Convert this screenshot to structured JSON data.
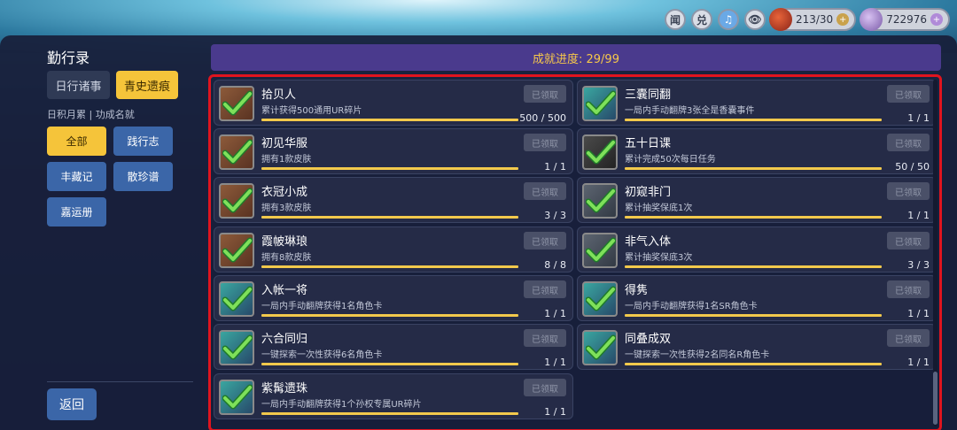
{
  "topbar": {
    "buttons": [
      {
        "label": "闻",
        "icon": "news-icon"
      },
      {
        "label": "兑",
        "icon": "exchange-icon"
      },
      {
        "label": "♫",
        "icon": "music-icon"
      },
      {
        "label": "👁",
        "icon": "eye-icon"
      }
    ],
    "stamina": {
      "value": "213/30",
      "icon": "pouch-icon"
    },
    "pearls": {
      "value": "722976",
      "icon": "pearl-icon"
    }
  },
  "sidebar": {
    "title": "勤行录",
    "tabs": [
      "日行诸事",
      "青史遗痕"
    ],
    "subtitle": "日积月累 | 功成名就",
    "categories": [
      "全部",
      "践行志",
      "丰藏记",
      "散珍谱",
      "嘉运册"
    ],
    "back_label": "返回"
  },
  "header": {
    "progress": "成就进度: 29/99"
  },
  "claim_label": "已领取",
  "achievements": [
    {
      "name": "拾贝人",
      "desc": "累计获得500通用UR碎片",
      "count": "500 / 500",
      "progress": 1.0,
      "thumb": "brown"
    },
    {
      "name": "三囊同翻",
      "desc": "一局内手动翻牌3张全是香囊事件",
      "count": "1 / 1",
      "progress": 1.0,
      "thumb": "teal"
    },
    {
      "name": "初见华服",
      "desc": "拥有1款皮肤",
      "count": "1 / 1",
      "progress": 1.0,
      "thumb": "brown"
    },
    {
      "name": "五十日课",
      "desc": "累计完成50次每日任务",
      "count": "50 / 50",
      "progress": 1.0,
      "thumb": "dark"
    },
    {
      "name": "衣冠小成",
      "desc": "拥有3款皮肤",
      "count": "3 / 3",
      "progress": 1.0,
      "thumb": "brown"
    },
    {
      "name": "初窥非门",
      "desc": "累计抽奖保底1次",
      "count": "1 / 1",
      "progress": 1.0,
      "thumb": "grey"
    },
    {
      "name": "霞帔琳琅",
      "desc": "拥有8款皮肤",
      "count": "8 / 8",
      "progress": 1.0,
      "thumb": "brown"
    },
    {
      "name": "非气入体",
      "desc": "累计抽奖保底3次",
      "count": "3 / 3",
      "progress": 1.0,
      "thumb": "grey"
    },
    {
      "name": "入帐一将",
      "desc": "一局内手动翻牌获得1名角色卡",
      "count": "1 / 1",
      "progress": 1.0,
      "thumb": "teal"
    },
    {
      "name": "得隽",
      "desc": "一局内手动翻牌获得1名SR角色卡",
      "count": "1 / 1",
      "progress": 1.0,
      "thumb": "teal"
    },
    {
      "name": "六合同归",
      "desc": "一键探索一次性获得6名角色卡",
      "count": "1 / 1",
      "progress": 1.0,
      "thumb": "teal"
    },
    {
      "name": "同叠成双",
      "desc": "一键探索一次性获得2名同名R角色卡",
      "count": "1 / 1",
      "progress": 1.0,
      "thumb": "teal"
    },
    {
      "name": "紫髯遗珠",
      "desc": "一局内手动翻牌获得1个孙权专属UR碎片",
      "count": "1 / 1",
      "progress": 1.0,
      "thumb": "teal"
    }
  ]
}
